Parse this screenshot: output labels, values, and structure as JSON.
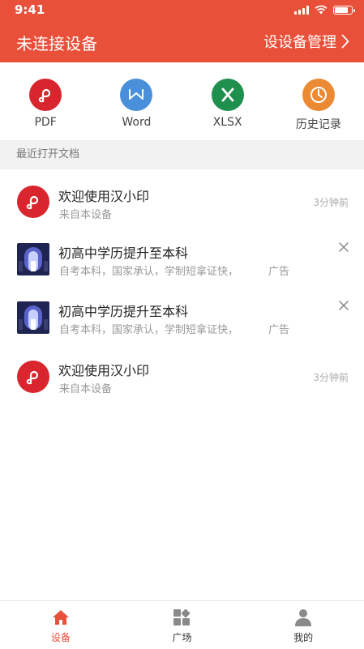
{
  "status_bar": {
    "time": "9:41",
    "battery_level": 0.85
  },
  "header": {
    "title": "未连接设备",
    "device_management_label": "设设备管理"
  },
  "quick_actions": [
    {
      "label": "PDF",
      "icon": "pdf-icon",
      "color": "#d9262e"
    },
    {
      "label": "Word",
      "icon": "word-icon",
      "color": "#4a8fd9"
    },
    {
      "label": "XLSX",
      "icon": "xlsx-icon",
      "color": "#1e8f4c"
    },
    {
      "label": "历史记录",
      "icon": "history-clock-icon",
      "color": "#ec8a34"
    }
  ],
  "recent_section": {
    "title": "最近打开文档"
  },
  "recent_items": [
    {
      "type": "document",
      "title": "欢迎使用汉小印",
      "subtitle": "来自本设备",
      "time": "3分钟前"
    },
    {
      "type": "ad",
      "title": "初高中学历提升至本科",
      "subtitle": "自考本科，国家承认，学制短拿证快，",
      "badge": "广告"
    },
    {
      "type": "ad",
      "title": "初高中学历提升至本科",
      "subtitle": "自考本科，国家承认，学制短拿证快，",
      "badge": "广告"
    },
    {
      "type": "document",
      "title": "欢迎使用汉小印",
      "subtitle": "来自本设备",
      "time": "3分钟前"
    }
  ],
  "tabs": [
    {
      "label": "设备",
      "icon": "home-icon",
      "active": true
    },
    {
      "label": "广场",
      "icon": "grid-icon",
      "active": false
    },
    {
      "label": "我的",
      "icon": "user-icon",
      "active": false
    }
  ],
  "colors": {
    "accent": "#e9503a",
    "pdf_red": "#d9262e"
  }
}
